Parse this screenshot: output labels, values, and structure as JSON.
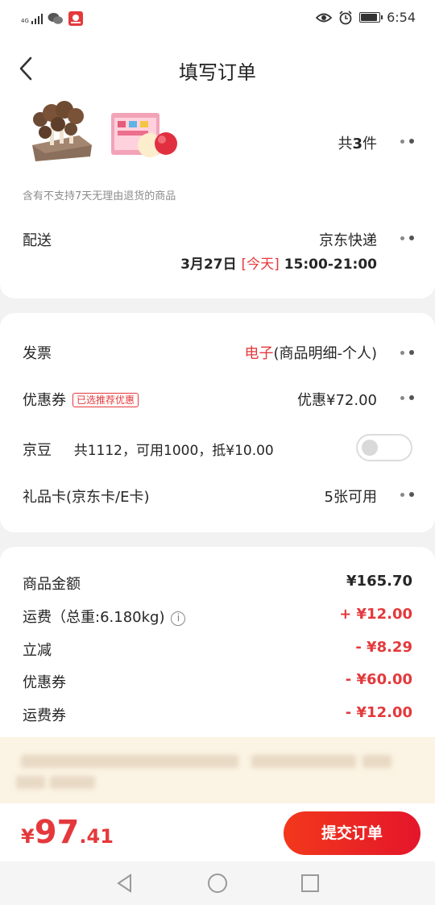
{
  "status": {
    "network": "4G",
    "time": "6:54",
    "battery_level": 0.85,
    "icons": [
      "signal-icon",
      "wechat-icon",
      "app-notification-icon",
      "eye-icon",
      "alarm-icon",
      "battery-icon"
    ]
  },
  "header": {
    "title": "填写订单",
    "back_icon": "chevron-left-icon"
  },
  "order": {
    "count_prefix": "共",
    "count": "3",
    "count_suffix": "件",
    "notice": "含有不支持7天无理由退货的商品",
    "delivery_label": "配送",
    "delivery_company": "京东快递",
    "delivery_date": "3月27日",
    "delivery_today": "[今天]",
    "delivery_time": "15:00-21:00"
  },
  "benefits": {
    "invoice_label": "发票",
    "invoice_type": "电子",
    "invoice_detail": "(商品明细-个人)",
    "coupon_label": "优惠券",
    "coupon_tag": "已选推荐优惠",
    "coupon_value": "优惠¥72.00",
    "jd_bean_label": "京豆",
    "jd_bean_info": "共1112，可用1000，抵¥10.00",
    "jd_bean_enabled": false,
    "giftcard_label": "礼品卡(京东卡/E卡)",
    "giftcard_value": "5张可用"
  },
  "summary": [
    {
      "label": "商品金额",
      "amount": "¥165.70",
      "color": "#262626"
    },
    {
      "label": "运费（总重:6.180kg)",
      "amount": "+ ¥12.00",
      "color": "#e4393c",
      "info_icon": "i"
    },
    {
      "label": "立减",
      "amount": "- ¥8.29",
      "color": "#e4393c"
    },
    {
      "label": "优惠券",
      "amount": "- ¥60.00",
      "color": "#e4393c"
    },
    {
      "label": "运费券",
      "amount": "- ¥12.00",
      "color": "#e4393c"
    }
  ],
  "footer": {
    "currency": "¥",
    "price_int": "97",
    "price_dec": ".41",
    "submit_label": "提交订单"
  },
  "colors": {
    "accent": "#e4393c",
    "banner_bg": "#fbf3e3"
  }
}
